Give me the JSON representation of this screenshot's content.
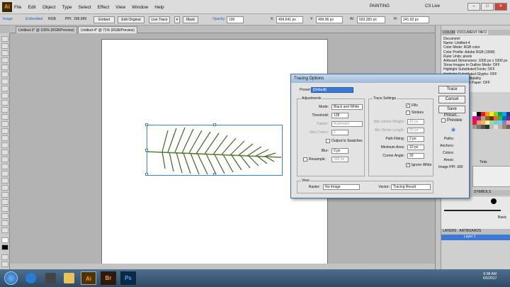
{
  "app": {
    "logo": "Ai",
    "workspace": "PAINTING",
    "cs_live": "CS Live"
  },
  "menu": [
    "File",
    "Edit",
    "Object",
    "Type",
    "Select",
    "Effect",
    "View",
    "Window",
    "Help"
  ],
  "control": {
    "selection": "Image",
    "embedded": "Embedded",
    "color_mode": "RGB",
    "ppi_label": "PPI:",
    "ppi": "299.999",
    "embed": "Embed",
    "edit_original": "Edit Original",
    "live_trace": "Live Trace",
    "mask": "Mask",
    "opacity_label": "Opacity:",
    "opacity": "100",
    "x": "499.641 px",
    "y": "499.96 px",
    "w": "593.283 px",
    "h": "241.92 px"
  },
  "tabs": [
    "Untitled-3* @ 100% (RGB/Preview)",
    "Untitled-4* @ 71% (RGB/Preview)"
  ],
  "dialog": {
    "title": "Tracing Options",
    "preset_label": "Preset:",
    "preset": "[Default]",
    "adjustments": "Adjustments",
    "mode_label": "Mode:",
    "mode": "Black and White",
    "threshold_label": "Threshold:",
    "threshold": "128",
    "palette_label": "Palette:",
    "palette": "Automatic",
    "max_colors_label": "Max Colors:",
    "max_colors": "6",
    "output_swatches": "Output to Swatches",
    "blur_label": "Blur:",
    "blur": "0 px",
    "resample_label": "Resample:",
    "resample": "300 px",
    "trace_settings": "Trace Settings",
    "fills": "Fills",
    "strokes": "Strokes",
    "max_stroke_label": "Max Stroke Weight:",
    "max_stroke": "10 px",
    "min_stroke_label": "Min Stroke Length:",
    "min_stroke": "20 px",
    "path_fit_label": "Path Fitting:",
    "path_fit": "2 px",
    "min_area_label": "Minimum Area:",
    "min_area": "10 px",
    "corner_label": "Corner Angle:",
    "corner": "20",
    "ignore_white": "Ignore White",
    "view": "View",
    "raster_label": "Raster:",
    "raster": "No Image",
    "vector_label": "Vector:",
    "vector": "Tracing Result",
    "btn_trace": "Trace",
    "btn_cancel": "Cancel",
    "btn_save": "Save Preset...",
    "preview": "Preview",
    "paths": "Paths:",
    "anchors": "Anchors:",
    "colors": "Colors:",
    "areas": "Areas:",
    "image_ppi": "Image PPI: 300"
  },
  "panel": {
    "tabs": [
      "COLOR",
      "DOCUMENT INFO"
    ],
    "info": [
      "Document:",
      "Name: Untitled-4",
      "Color Mode: RGB color",
      "Color Profile: Adobe RGB (1998)",
      "Ruler Units: pixels",
      "Artboard Dimensions: 1000 px x 1000 px",
      "Show Images In Outline Mode: OFF",
      "Highlight Substituted Fonts: OFF",
      "Highlight Substituted Glyphs: OFF",
      "Preserve Text Editability",
      "Simulate Colored Paper: OFF"
    ],
    "swatch_label": "Tints",
    "symbols": "SYMBOLS",
    "brush": "Basic",
    "layers_tabs": [
      "LAYERS",
      "ARTBOARDS"
    ],
    "layer": "Layer 1"
  },
  "taskbar": {
    "time": "6:08 AM",
    "date": "6/5/2017"
  }
}
